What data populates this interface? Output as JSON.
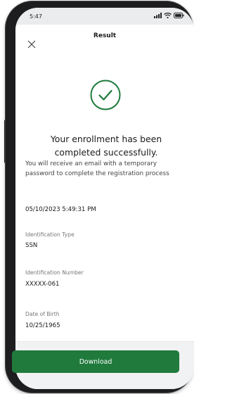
{
  "status_bar": {
    "time": "5:47",
    "icons": [
      "signal-icon",
      "wifi-icon",
      "battery-icon"
    ]
  },
  "header": {
    "close_icon": "close-icon",
    "title": "Result"
  },
  "result": {
    "icon": "check-circle-icon",
    "headline_line1": "Your enrollment has been",
    "headline_line2": "completed successfully.",
    "message": "You will receive an email with a temporary password to complete the registration process",
    "timestamp": "05/10/2023 5:49:31 PM"
  },
  "fields": [
    {
      "label": "Identification Type",
      "value": "SSN"
    },
    {
      "label": "Identification Number",
      "value": "XXXXX-061"
    },
    {
      "label": "Date of Birth",
      "value": "10/25/1965"
    }
  ],
  "footer": {
    "download_label": "Download"
  },
  "colors": {
    "accent": "#1f7a3c",
    "status_bar_bg": "#ebeced",
    "footer_bg": "#f1f2f3"
  }
}
